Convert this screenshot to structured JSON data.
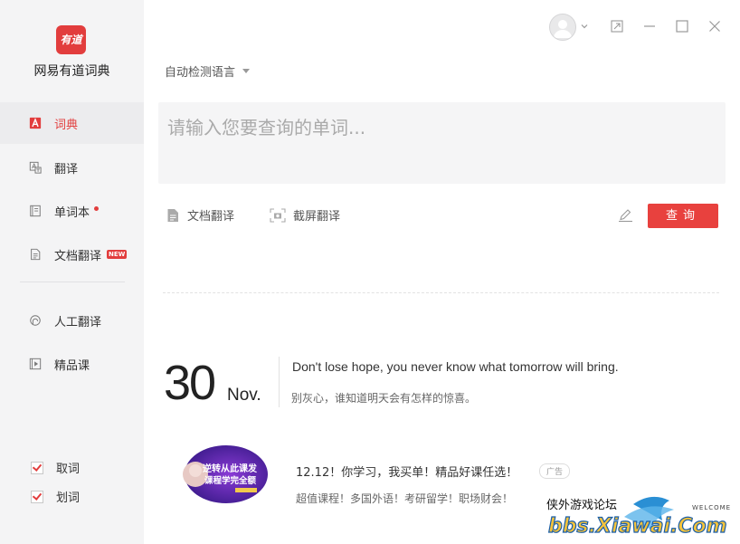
{
  "app": {
    "name": "网易有道词典",
    "logo_text": "有道"
  },
  "sidebar": {
    "items": [
      {
        "label": "词典",
        "icon": "dictionary-a-icon",
        "active": true
      },
      {
        "label": "翻译",
        "icon": "translate-icon"
      },
      {
        "label": "单词本",
        "icon": "wordbook-icon",
        "has_dot": true
      },
      {
        "label": "文档翻译",
        "icon": "document-icon",
        "badge": "NEW"
      },
      {
        "label": "人工翻译",
        "icon": "headset-icon"
      },
      {
        "label": "精品课",
        "icon": "video-course-icon"
      }
    ],
    "checks": [
      {
        "label": "取词",
        "checked": true
      },
      {
        "label": "划词",
        "checked": true
      }
    ]
  },
  "header": {
    "language_select": "自动检测语言"
  },
  "search": {
    "placeholder": "请输入您要查询的单词..."
  },
  "tools": {
    "doc_translate": "文档翻译",
    "screenshot_translate": "截屏翻译"
  },
  "query_button": "查询",
  "daily": {
    "day": "30",
    "month": "Nov.",
    "quote_en": "Don't lose hope, you never know what tomorrow will bring.",
    "quote_zh": "别灰心，谁知道明天会有怎样的惊喜。"
  },
  "ad": {
    "image_text_1": "逆转从此课发",
    "image_text_2": "课程学完全额",
    "title": "12.12！你学习，我买单！精品好课任选！",
    "badge": "广告",
    "subtitle": "超值课程！多国外语！考研留学！职场财会！"
  },
  "watermark": {
    "top_text": "侠外游戏论坛",
    "main_text": "bbs.Xiawai.Com",
    "welcome": "WELCOME"
  },
  "colors": {
    "accent": "#e23d3d",
    "sidebar_bg": "#f4f4f5",
    "search_bg": "#f5f5f6"
  }
}
